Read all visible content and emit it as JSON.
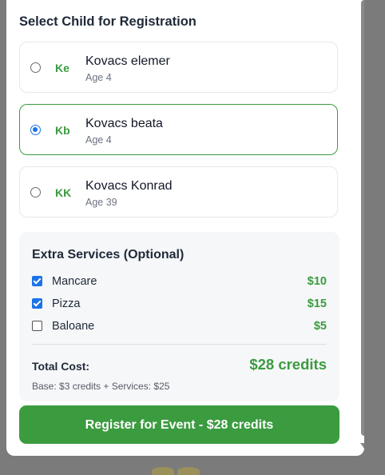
{
  "modal": {
    "section_title": "Select Child for Registration",
    "children": [
      {
        "initials": "Ke",
        "name": "Kovacs elemer",
        "age": "Age 4",
        "selected": false
      },
      {
        "initials": "Kb",
        "name": "Kovacs beata",
        "age": "Age 4",
        "selected": true
      },
      {
        "initials": "KK",
        "name": "Kovacs Konrad",
        "age": "Age 39",
        "selected": false
      }
    ],
    "services": {
      "title": "Extra Services (Optional)",
      "items": [
        {
          "label": "Mancare",
          "price": "$10",
          "checked": true
        },
        {
          "label": "Pizza",
          "price": "$15",
          "checked": true
        },
        {
          "label": "Baloane",
          "price": "$5",
          "checked": false
        }
      ],
      "total_label": "Total Cost:",
      "total_value": "$28 credits",
      "breakdown": "Base: $3 credits + Services: $25"
    },
    "register_label": "Register for Event - $28 credits"
  },
  "colors": {
    "accent": "#3b9b3f",
    "radio_checked": "#1a73e8",
    "backdrop": "#7b7b7b"
  }
}
